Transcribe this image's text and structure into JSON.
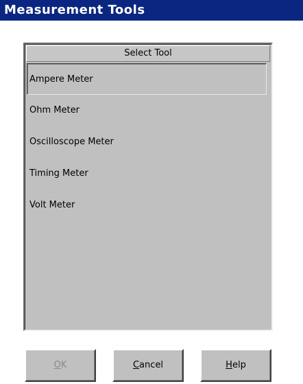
{
  "window": {
    "title": "Measurement Tools"
  },
  "list": {
    "header": "Select Tool",
    "items": [
      {
        "label": "Ampere Meter",
        "selected": true
      },
      {
        "label": "Ohm Meter",
        "selected": false
      },
      {
        "label": "Oscilloscope Meter",
        "selected": false
      },
      {
        "label": "Timing Meter",
        "selected": false
      },
      {
        "label": "Volt Meter",
        "selected": false
      }
    ]
  },
  "buttons": {
    "ok": {
      "mnemonic": "O",
      "rest": "K",
      "enabled": false
    },
    "cancel": {
      "mnemonic": "C",
      "rest": "ancel",
      "enabled": true
    },
    "help": {
      "mnemonic": "H",
      "rest": "elp",
      "enabled": true
    }
  }
}
